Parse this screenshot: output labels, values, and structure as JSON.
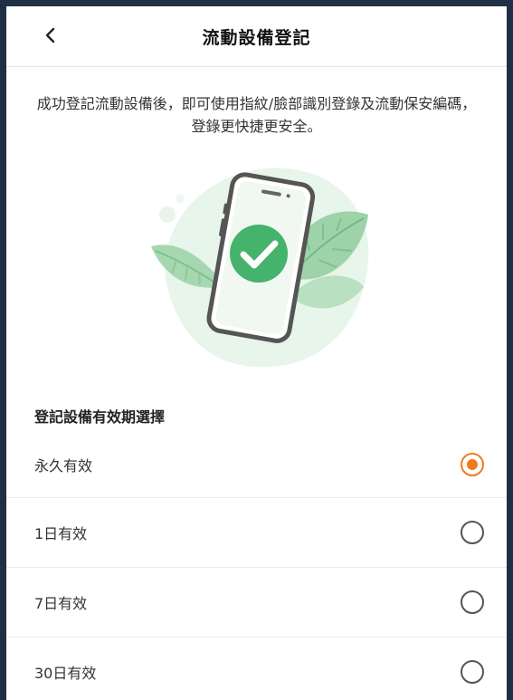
{
  "header": {
    "back_icon": "chevron-left-icon",
    "title": "流動設備登記"
  },
  "intro": {
    "text": "成功登記流動設備後，即可使用指紋/臉部識別登錄及流動保安編碼，登錄更快捷更安全。"
  },
  "illustration": {
    "icon": "phone-checkmark-icon"
  },
  "validity": {
    "section_title": "登記設備有效期選擇",
    "selected_index": 0,
    "options": [
      {
        "label": "永久有效",
        "selected": true
      },
      {
        "label": "1日有效",
        "selected": false
      },
      {
        "label": "7日有效",
        "selected": false
      },
      {
        "label": "30日有效",
        "selected": false
      }
    ]
  },
  "colors": {
    "accent": "#f07a1e",
    "check_green": "#45b36b",
    "frame": "#1f2f46"
  }
}
